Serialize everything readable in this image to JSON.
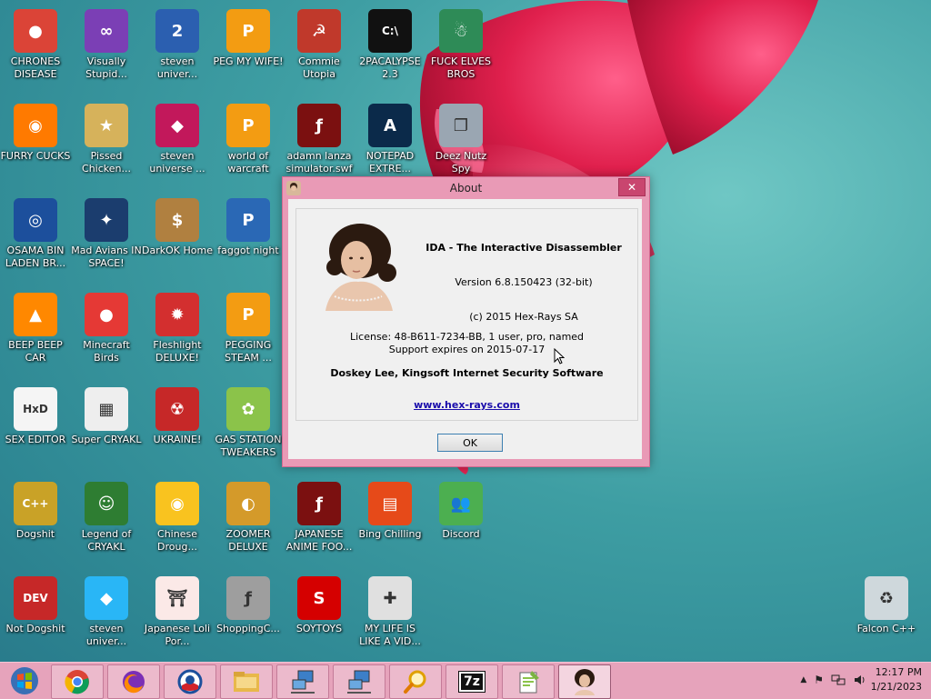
{
  "desktop": {
    "icons": [
      {
        "label": "CHRONES DISEASE",
        "icon": "chrome-icon"
      },
      {
        "label": "Visually Stupid...",
        "icon": "visual-studio-icon"
      },
      {
        "label": "steven univer...",
        "icon": "steven-universe-2-icon"
      },
      {
        "label": "PEG MY WIFE!",
        "icon": "peggle-icon"
      },
      {
        "label": "Commie Utopia",
        "icon": "commie-eagle-icon"
      },
      {
        "label": "2PACALYPSE 2.3",
        "icon": "command-prompt-icon"
      },
      {
        "label": "FUCK ELVES BROS",
        "icon": "elf-santa-icon"
      },
      {
        "label": "FURRY CUCKS",
        "icon": "firefox-icon"
      },
      {
        "label": "Pissed Chicken...",
        "icon": "angry-birds-seasons-icon"
      },
      {
        "label": "steven universe ...",
        "icon": "steven-universe-gem-icon"
      },
      {
        "label": "world of warcraft",
        "icon": "peggle-icon"
      },
      {
        "label": "adamn lanza simulator.swf",
        "icon": "flash-icon"
      },
      {
        "label": "NOTEPAD EXTRE...",
        "icon": "notepad-extreme-icon"
      },
      {
        "label": "Deez Nutz Spy",
        "icon": "windows-stack-icon"
      },
      {
        "label": "OSAMA BIN LADEN BR...",
        "icon": "obama-logo-icon"
      },
      {
        "label": "Mad Avians IN SPACE!",
        "icon": "angry-birds-space-icon"
      },
      {
        "label": "DarkOK Home",
        "icon": "money-bag-icon"
      },
      {
        "label": "faggot night",
        "icon": "peggle-nights-icon"
      },
      {
        "label": "BEEP BEEP CAR",
        "icon": "vlc-cone-icon"
      },
      {
        "label": "Minecraft Birds",
        "icon": "angry-birds-icon"
      },
      {
        "label": "Fleshlight DELUXE!",
        "icon": "red-fuzzball-icon"
      },
      {
        "label": "PEGGING STEAM ...",
        "icon": "peggle-icon"
      },
      {
        "label": "SEX EDITOR",
        "icon": "hxd-icon"
      },
      {
        "label": "Super CRYAKL",
        "icon": "pixel-cat-icon"
      },
      {
        "label": "UKRAINE!",
        "icon": "radiation-icon"
      },
      {
        "label": "GAS STATION TWEAKERS",
        "icon": "flower-icon"
      },
      {
        "label": "Dogshit",
        "icon": "code-blocks-icon"
      },
      {
        "label": "Legend of CRYAKL",
        "icon": "pixel-hero-icon"
      },
      {
        "label": "Chinese Droug...",
        "icon": "mahjong-tile-icon"
      },
      {
        "label": "ZOOMER DELUXE",
        "icon": "zuma-icon"
      },
      {
        "label": "JAPANESE ANIME FOO...",
        "icon": "flash-icon"
      },
      {
        "label": "Bing Chilling",
        "icon": "book-icon"
      },
      {
        "label": "Discord",
        "icon": "messenger-people-icon"
      },
      {
        "label": "Not Dogshit",
        "icon": "dev-cpp-icon"
      },
      {
        "label": "steven univer...",
        "icon": "diamond-icon"
      },
      {
        "label": "Japanese Loli Por...",
        "icon": "torii-gate-icon"
      },
      {
        "label": "ShoppingC...",
        "icon": "flash-player-icon"
      },
      {
        "label": "SOYTOYS",
        "icon": "soy-s-icon"
      },
      {
        "label": "MY LIFE IS LIKE A VID...",
        "icon": "gamepad-icon"
      },
      {
        "label": "Falcon C++",
        "icon": "recycle-bin-icon"
      }
    ]
  },
  "about_dialog": {
    "title": "About",
    "close_glyph": "✕",
    "product": "IDA - The Interactive Disassembler",
    "version": "Version 6.8.150423 (32-bit)",
    "copyright": "(c) 2015 Hex-Rays SA",
    "license": "License: 48-B611-7234-BB, 1 user, pro, named",
    "support": "Support expires on 2015-07-17",
    "owner": "Doskey Lee, Kingsoft Internet Security Software",
    "link": "www.hex-rays.com",
    "ok_label": "OK"
  },
  "taskbar": {
    "pinned": [
      "start-orb",
      "chrome",
      "firefox",
      "obama-logo",
      "file-explorer",
      "network-utility",
      "network-utility-2",
      "magnifier",
      "7-zip",
      "notepad-plus",
      "ida-portrait"
    ],
    "seven_zip_label": "7z",
    "clock_time": "12:17 PM",
    "clock_date": "1/21/2023",
    "tray_icons": [
      "show-hidden-icons",
      "action-center-flag",
      "network",
      "volume"
    ]
  },
  "colors": {
    "desktop_teal": "#3e9ea3",
    "window_frame_pink": "#e99ab6",
    "taskbar_pink": "#e6a3bb",
    "close_button": "#c9466f"
  }
}
